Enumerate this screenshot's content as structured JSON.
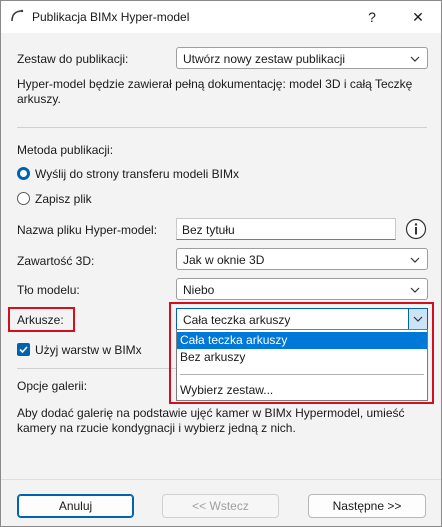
{
  "window": {
    "title": "Publikacja BIMx Hyper-model",
    "help_label": "?",
    "close_label": "✕"
  },
  "publish_set": {
    "label": "Zestaw do publikacji:",
    "value": "Utwórz nowy zestaw publikacji"
  },
  "info_text": "Hyper-model będzie zawierał pełną dokumentację: model 3D i całą Teczkę arkuszy.",
  "method": {
    "label": "Metoda publikacji:",
    "options": [
      {
        "label": "Wyślij do strony transferu modeli BIMx",
        "selected": true
      },
      {
        "label": "Zapisz plik",
        "selected": false
      }
    ]
  },
  "file_name": {
    "label": "Nazwa pliku Hyper-model:",
    "value": "Bez tytułu",
    "info_icon": "info-icon"
  },
  "content3d": {
    "label": "Zawartość 3D:",
    "value": "Jak w oknie 3D"
  },
  "background": {
    "label": "Tło modelu:",
    "value": "Niebo"
  },
  "sheets": {
    "label": "Arkusze:",
    "value": "Cała teczka arkuszy",
    "options": [
      "Cała teczka arkuszy",
      "Bez arkuszy",
      "Wybierz zestaw..."
    ],
    "selected_index": 0
  },
  "use_layers": {
    "label": "Użyj warstw w BIMx",
    "checked": true
  },
  "gallery": {
    "label": "Opcje galerii:",
    "text": "Aby dodać galerię na podstawie ujęć kamer w BIMx Hypermodel, umieść kamery na rzucie kondygnacji i wybierz jedną z nich."
  },
  "footer": {
    "cancel": "Anuluj",
    "back": "<< Wstecz",
    "next": "Następne >>"
  },
  "colors": {
    "accent": "#0063b1",
    "highlight": "#0078d7",
    "annotation_red": "#d10f1f"
  }
}
